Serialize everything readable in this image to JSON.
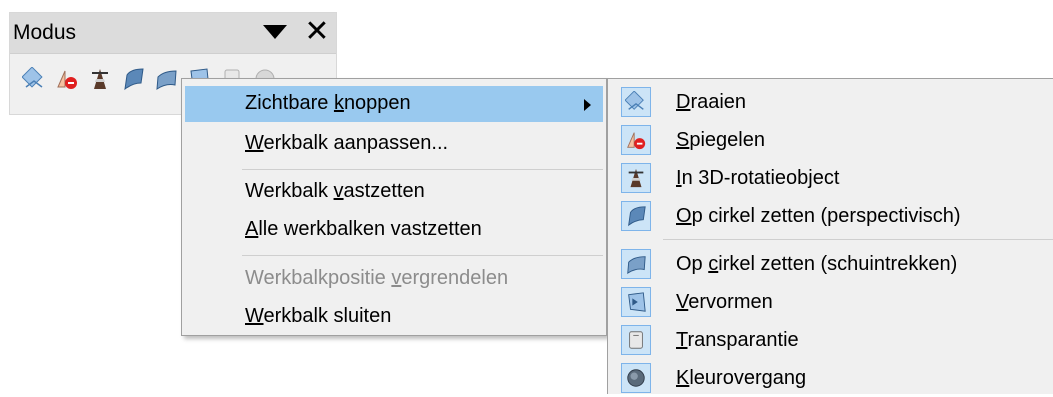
{
  "toolbar": {
    "title": "Modus",
    "icons": [
      "rotate-icon",
      "flip-icon",
      "3d-rotation-object-icon",
      "circle-perspective-icon",
      "circle-slant-icon",
      "distort-icon",
      "transparency-icon",
      "gradient-icon"
    ]
  },
  "context_menu": {
    "items": [
      {
        "pre": "Zichtbare ",
        "key": "k",
        "post": "noppen"
      },
      {
        "pre": "",
        "key": "W",
        "post": "erkbalk aanpassen..."
      },
      {
        "pre": "Werkbalk ",
        "key": "v",
        "post": "astzetten"
      },
      {
        "pre": "",
        "key": "A",
        "post": "lle werkbalken vastzetten"
      },
      {
        "pre": "Werkbalkpositie ",
        "key": "v",
        "post": "ergrendelen"
      },
      {
        "pre": "",
        "key": "W",
        "post": "erkbalk sluiten"
      }
    ]
  },
  "submenu": {
    "items": [
      {
        "pre": "",
        "key": "D",
        "post": "raaien",
        "icon": "rotate-icon"
      },
      {
        "pre": "",
        "key": "S",
        "post": "piegelen",
        "icon": "flip-icon"
      },
      {
        "pre": "",
        "key": "I",
        "post": "n 3D-rotatieobject",
        "icon": "3d-rotation-object-icon"
      },
      {
        "pre": "",
        "key": "O",
        "post": "p cirkel zetten (perspectivisch)",
        "icon": "circle-perspective-icon"
      },
      {
        "pre": "Op ",
        "key": "c",
        "post": "irkel zetten (schuintrekken)",
        "icon": "circle-slant-icon"
      },
      {
        "pre": "",
        "key": "V",
        "post": "ervormen",
        "icon": "distort-icon"
      },
      {
        "pre": "",
        "key": "T",
        "post": "ransparantie",
        "icon": "transparency-icon"
      },
      {
        "pre": "",
        "key": "K",
        "post": "leurovergang",
        "icon": "gradient-icon"
      }
    ]
  },
  "colors": {
    "highlight": "#99c9ef",
    "check_bg": "#cce4f7",
    "disabled_text": "#8c8c8c"
  }
}
